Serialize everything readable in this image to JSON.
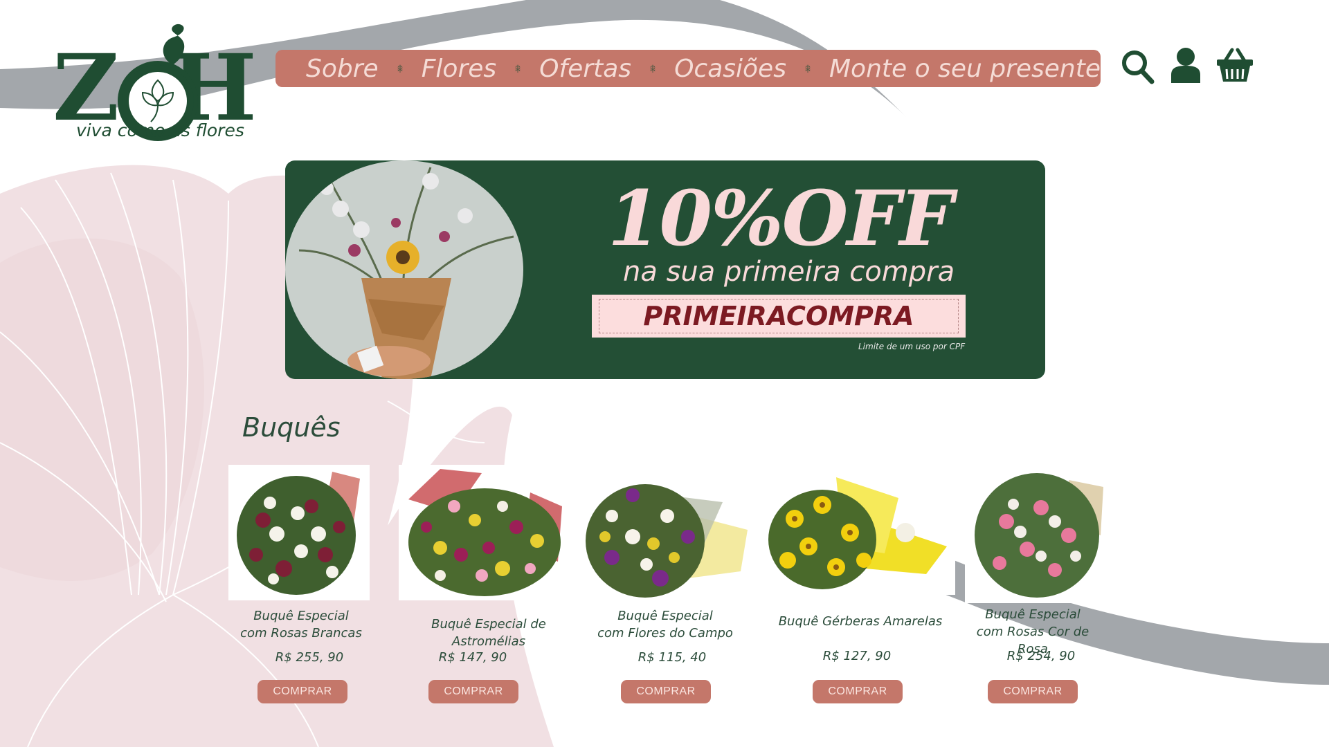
{
  "brand": {
    "name": "ZOH",
    "tagline": "viva como as flores"
  },
  "nav": {
    "items": [
      {
        "label": "Sobre"
      },
      {
        "label": "Flores"
      },
      {
        "label": "Ofertas"
      },
      {
        "label": "Ocasiões"
      },
      {
        "label": "Monte o seu presente"
      }
    ]
  },
  "header_icons": [
    "search-icon",
    "user-icon",
    "cart-icon"
  ],
  "promo": {
    "headline": "10%OFF",
    "subtitle": "na sua primeira compra",
    "coupon_code": "PRIMEIRACOMPRA",
    "limit_note": "Limite de um uso por CPF"
  },
  "section": {
    "title": "Buquês"
  },
  "products": [
    {
      "name": "Buquê Especial\ncom Rosas Brancas",
      "price": "R$ 255, 90",
      "buy_label": "COMPRAR"
    },
    {
      "name": "Buquê Especial de Astromélias",
      "price": "R$ 147, 90",
      "buy_label": "COMPRAR"
    },
    {
      "name": "Buquê Especial\ncom Flores do Campo",
      "price": "R$ 115, 40",
      "buy_label": "COMPRAR"
    },
    {
      "name": "Buquê Gérberas Amarelas",
      "price": "R$ 127, 90",
      "buy_label": "COMPRAR"
    },
    {
      "name": "Buquê Especial\ncom Rosas Cor de Rosa",
      "price": "R$ 254, 90",
      "buy_label": "COMPRAR"
    }
  ],
  "colors": {
    "dark_green": "#234f35",
    "nav_salmon": "#c4776a",
    "coupon_pink": "#fcdddd",
    "coupon_text": "#7c1a22",
    "background_petal": "#f1e0e3",
    "swoosh_gray": "#a3a7ab"
  }
}
